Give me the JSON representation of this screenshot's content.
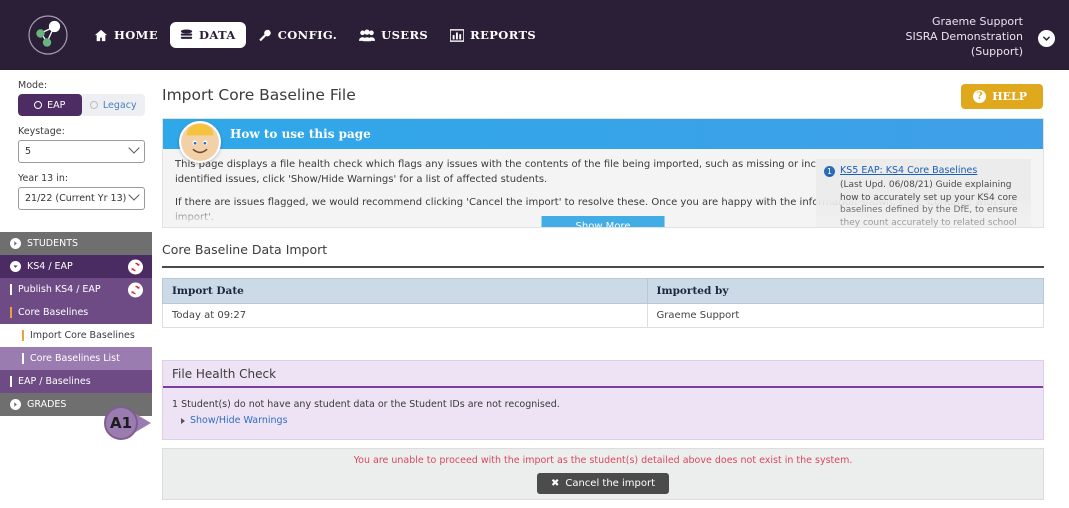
{
  "header": {
    "logo_icon": "network-nodes-logo",
    "nav": [
      {
        "label": "HOME",
        "icon": "home-icon",
        "active": false
      },
      {
        "label": "DATA",
        "icon": "database-icon",
        "active": true
      },
      {
        "label": "CONFIG.",
        "icon": "wrench-icon",
        "active": false
      },
      {
        "label": "USERS",
        "icon": "users-icon",
        "active": false
      },
      {
        "label": "REPORTS",
        "icon": "bar-chart-icon",
        "active": false
      }
    ],
    "user": {
      "name": "Graeme Support",
      "organisation": "SISRA Demonstration",
      "role": "(Support)",
      "chevron_icon": "chevron-down-icon"
    }
  },
  "sidebar": {
    "mode_label": "Mode:",
    "mode_options": [
      {
        "label": "EAP",
        "selected": true
      },
      {
        "label": "Legacy",
        "selected": false
      }
    ],
    "keystage_label": "Keystage:",
    "keystage_value": "5",
    "year_label": "Year 13 in:",
    "year_value": "21/22 (Current Yr 13)",
    "menu": [
      {
        "label": "STUDENTS",
        "style": "grey",
        "icon": "circle-arrow-icon",
        "badge": false
      },
      {
        "label": "KS4 / EAP",
        "style": "dark",
        "icon": "circle-chevron-down-icon",
        "badge": true,
        "badge_icon": "sync-icon"
      },
      {
        "label": "Publish KS4 / EAP",
        "style": "mid",
        "icon": "tick-white",
        "badge": true,
        "badge_icon": "sync-icon"
      },
      {
        "label": "Core Baselines",
        "style": "mid",
        "icon": "tick-orange",
        "badge": false
      },
      {
        "label": "Import Core Baselines",
        "style": "white",
        "icon": "tick-orange",
        "badge": false,
        "indent": true
      },
      {
        "label": "Core Baselines List",
        "style": "lilac",
        "icon": "tick-white",
        "badge": false,
        "indent": true
      },
      {
        "label": "EAP / Baselines",
        "style": "mid",
        "icon": "tick-white",
        "badge": false
      },
      {
        "label": "GRADES",
        "style": "grey",
        "icon": "circle-arrow-icon",
        "badge": false
      }
    ]
  },
  "main": {
    "page_title": "Import Core Baseline File",
    "help_button": "HELP",
    "help_icon": "question-mark-icon",
    "info_panel": {
      "avatar_icon": "person-avatar-icon",
      "title": "How to use this page",
      "paragraph1": "This page displays a file health check which flags any issues with the contents of the file being imported, such as missing or incorrect student IDs. If the health check has identified issues, click 'Show/Hide Warnings' for a list of affected students.",
      "paragraph2": "If there are issues flagged, we would recommend clicking 'Cancel the import' to resolve these. Once you are happy with the information shown, click 'Continue with the import'.",
      "show_more": "Show More",
      "guide": {
        "number": "1",
        "link": "KS5 EAP: KS4 Core Baselines",
        "description": "(Last Upd. 06/08/21) Guide explaining how to accurately set up your KS4 core baselines defined by the DfE, to ensure they count accurately to related school performance"
      }
    },
    "section_title": "Core Baseline Data Import",
    "table": {
      "columns": [
        "Import Date",
        "Imported by"
      ],
      "rows": [
        [
          "Today at 09:27",
          "Graeme Support"
        ]
      ]
    },
    "file_health_check": {
      "title": "File Health Check",
      "message": "1 Student(s) do not have any student data or the Student IDs are not recognised.",
      "toggle_link": "Show/Hide Warnings",
      "toggle_icon": "triangle-right-icon"
    },
    "footer": {
      "message": "You are unable to proceed with the import as the student(s) detailed above does not exist in the system.",
      "cancel_label": "Cancel the import",
      "cancel_icon": "close-x-icon"
    }
  },
  "annotation": {
    "marker_label": "A1"
  },
  "colors": {
    "header_bg": "#2b1f38",
    "accent_purple": "#4b2c62",
    "help_yellow": "#e0a81d",
    "info_blue": "#42ade4",
    "error_red": "#d9485f",
    "lilac_panel": "#ede3f5"
  }
}
